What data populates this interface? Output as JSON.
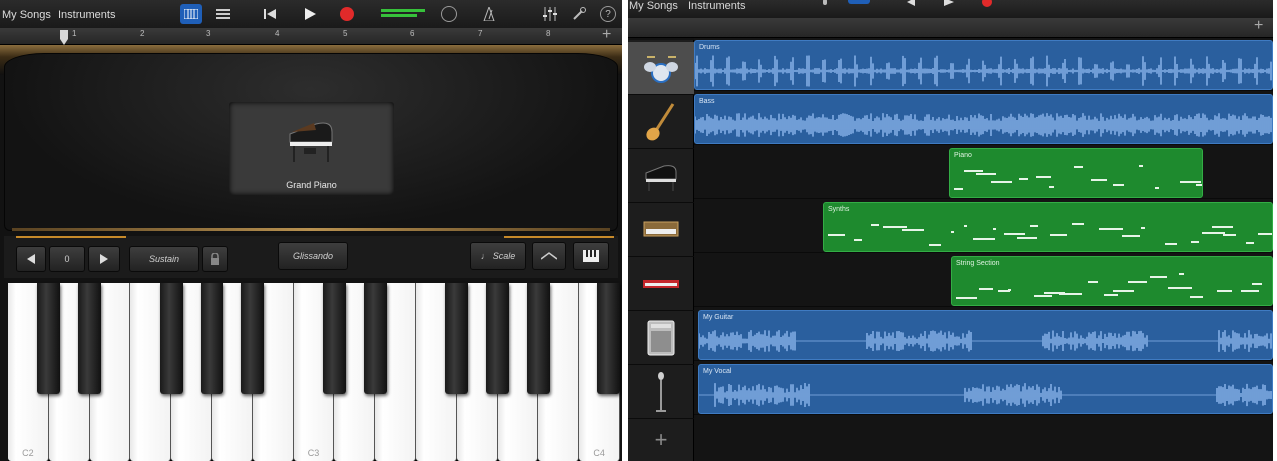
{
  "left": {
    "toolbar": {
      "my_songs": "My Songs",
      "instruments": "Instruments"
    },
    "ruler": {
      "marks": [
        "1",
        "2",
        "3",
        "4",
        "5",
        "6",
        "7",
        "8"
      ]
    },
    "instrument": {
      "name": "Grand Piano"
    },
    "controls": {
      "octave_value": "0",
      "sustain": "Sustain",
      "glissando": "Glissando",
      "scale": "Scale"
    },
    "keys": {
      "labels": [
        "C2",
        "C3",
        "C4"
      ]
    }
  },
  "right": {
    "toolbar": {
      "my_songs": "My Songs",
      "instruments": "Instruments"
    },
    "tracks": [
      {
        "name": "Drums",
        "kind": "audio",
        "icon": "drum-kit-icon"
      },
      {
        "name": "Bass",
        "kind": "audio",
        "icon": "bass-guitar-icon"
      },
      {
        "name": "Piano",
        "kind": "midi",
        "icon": "grand-piano-icon"
      },
      {
        "name": "Synths",
        "kind": "midi",
        "icon": "synth-icon"
      },
      {
        "name": "String Section",
        "kind": "midi",
        "icon": "keyboard-icon"
      },
      {
        "name": "My Guitar",
        "kind": "audio",
        "icon": "amp-icon"
      },
      {
        "name": "My Vocal",
        "kind": "audio",
        "icon": "microphone-icon"
      }
    ]
  },
  "colors": {
    "audio_region": "#2a5f9e",
    "midi_region": "#1e8a2e",
    "record": "#e12a2a",
    "accent": "#1f5fb8"
  }
}
